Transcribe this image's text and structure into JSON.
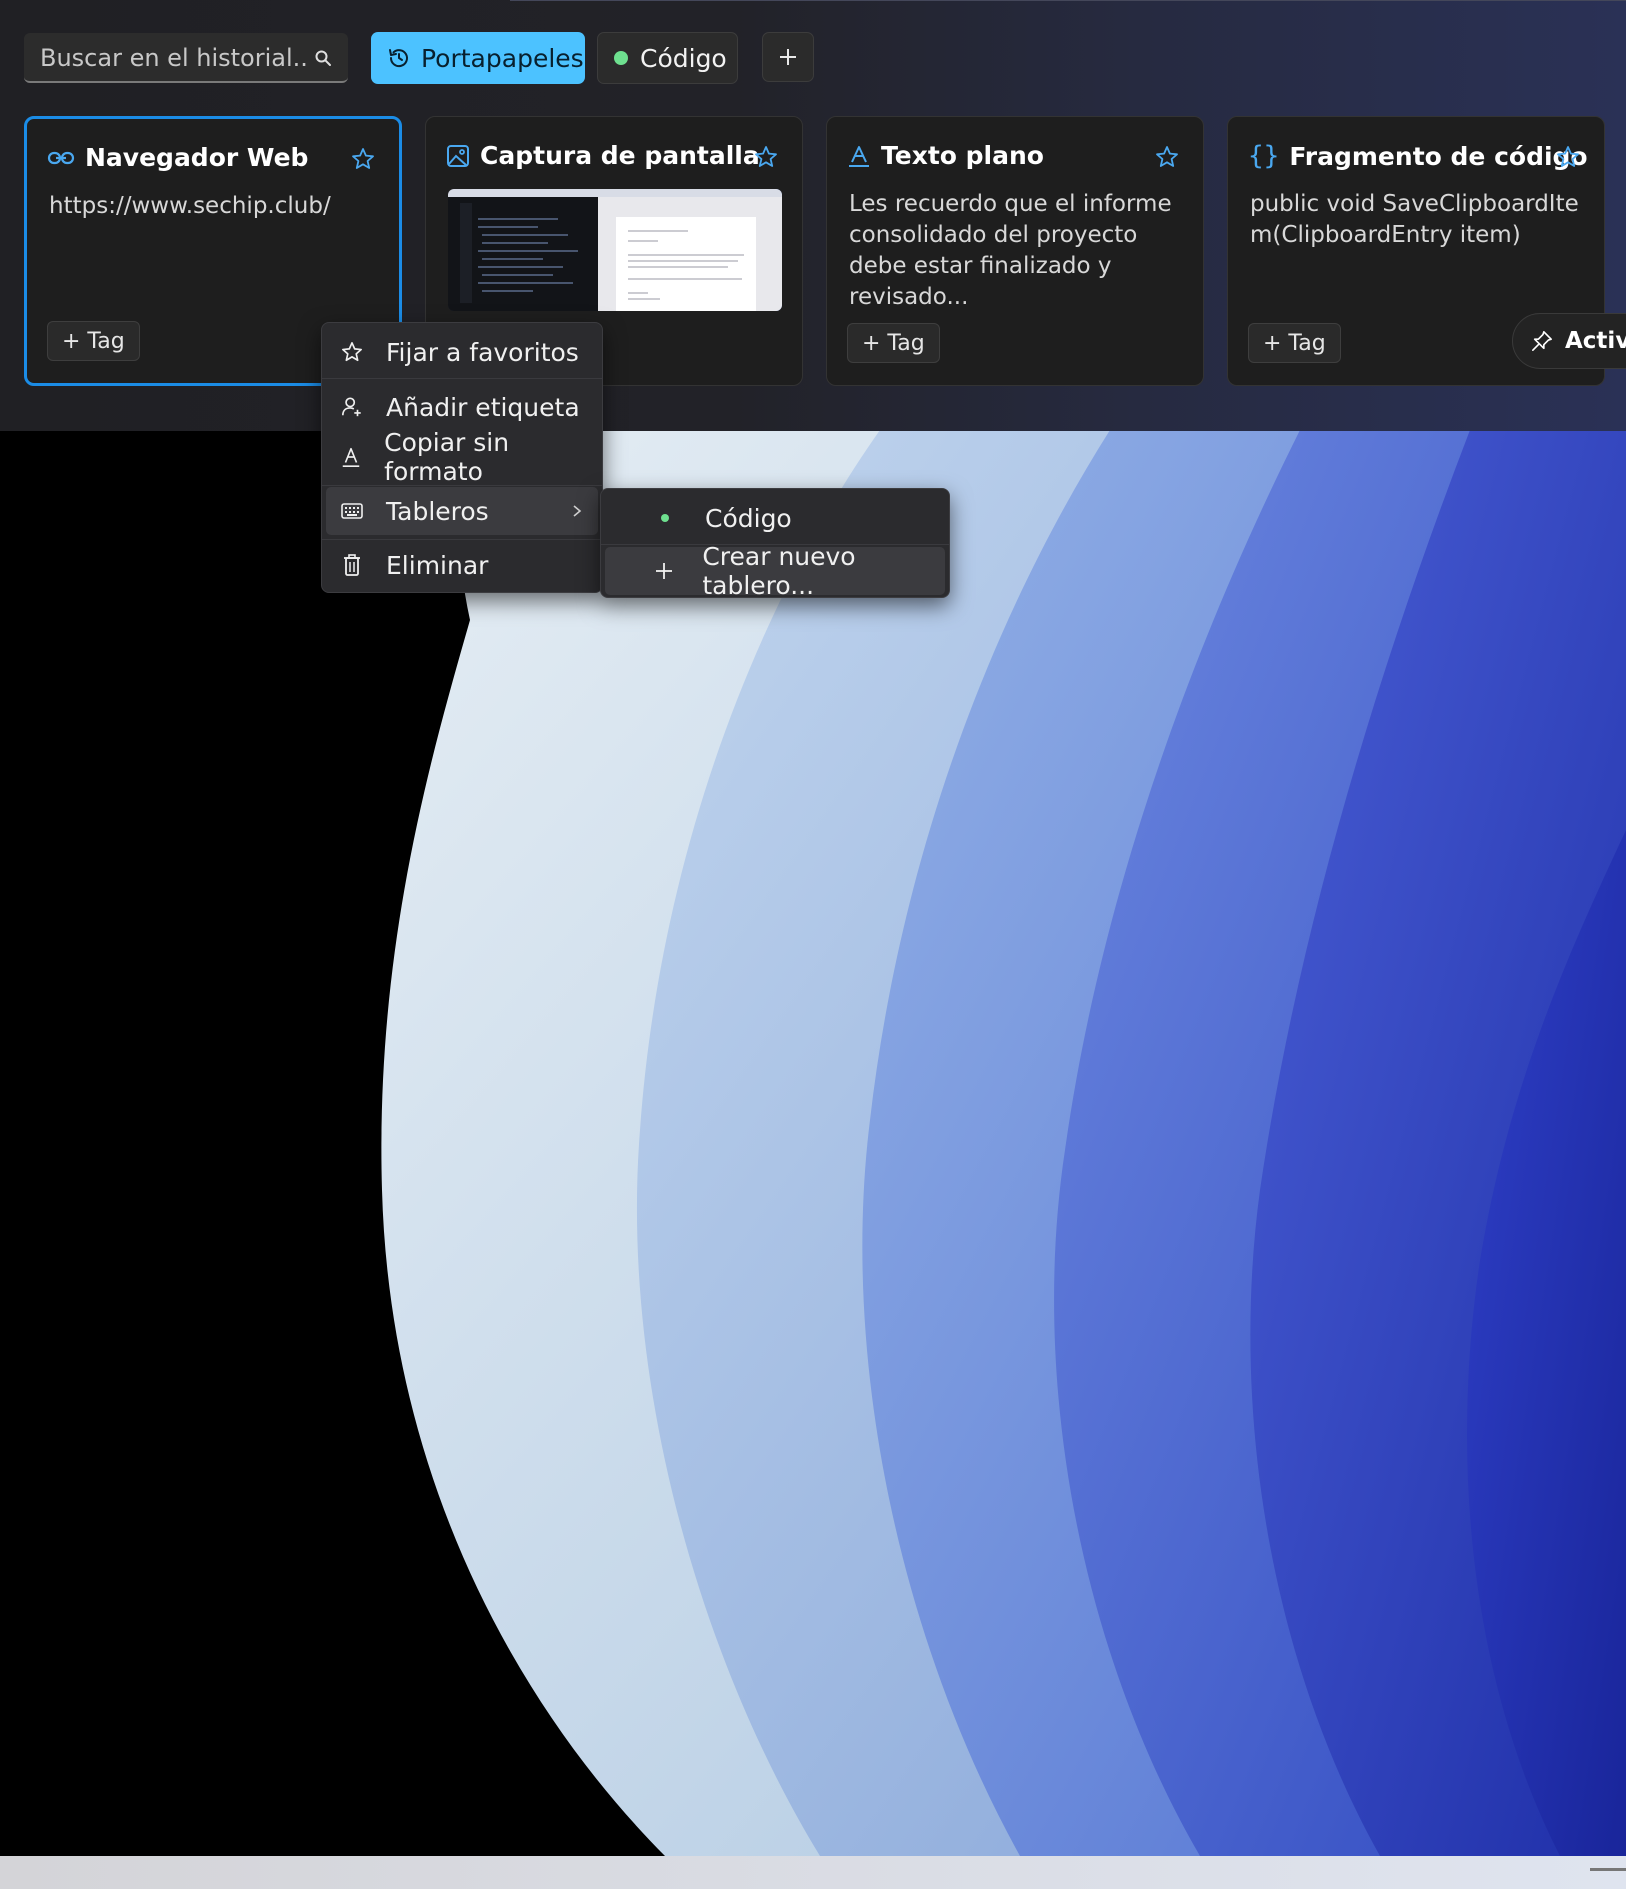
{
  "search": {
    "placeholder": "Buscar en el historial..."
  },
  "tabs": {
    "primary_label": "Portapapeles",
    "board_label": "Código",
    "board_dot_color": "#6ee08f",
    "add_symbol": "+"
  },
  "cards": [
    {
      "type": "link-icon",
      "title": "Navegador Web",
      "content": "https://www.sechip.club/",
      "tag_label": "+ Tag",
      "selected": true
    },
    {
      "type": "image-icon",
      "title": "Captura de pantalla",
      "content": "",
      "tag_label": ""
    },
    {
      "type": "text-icon",
      "title": "Texto plano",
      "content": "Les recuerdo que el informe consolidado del proyecto debe estar finalizado y revisado...",
      "tag_label": "+ Tag"
    },
    {
      "type": "code-icon",
      "title": "Fragmento de código",
      "content": "public void SaveClipboardItem(ClipboardEntry item)",
      "tag_label": "+ Tag"
    }
  ],
  "pin_button": {
    "label": "Activa"
  },
  "context_menu": {
    "items": [
      {
        "icon": "star-icon",
        "label": "Fijar a favoritos"
      },
      {
        "icon": "person-add-icon",
        "label": "Añadir etiqueta"
      },
      {
        "icon": "text-format-icon",
        "label": "Copiar sin formato"
      },
      {
        "icon": "keyboard-icon",
        "label": "Tableros",
        "has_submenu": true
      },
      {
        "icon": "trash-icon",
        "label": "Eliminar"
      }
    ]
  },
  "submenu": {
    "items": [
      {
        "icon": "dot-icon",
        "label": "Código"
      },
      {
        "icon": "plus-icon",
        "label": "Crear nuevo tablero..."
      }
    ]
  },
  "colors": {
    "accent": "#4cc2ff",
    "selection_border": "#1b8ce6",
    "icon_blue": "#4aa8f0"
  }
}
